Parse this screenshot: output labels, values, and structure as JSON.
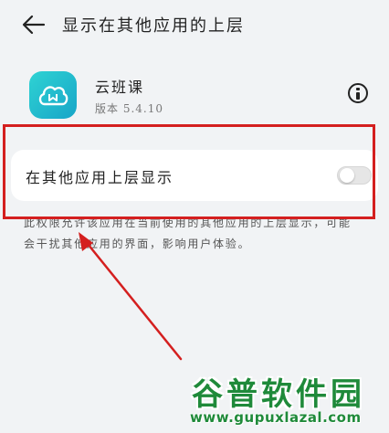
{
  "header": {
    "title": "显示在其他应用的上层"
  },
  "app": {
    "name": "云班课",
    "version": "版本 5.4.10"
  },
  "setting": {
    "label": "在其他应用上层显示",
    "enabled": false
  },
  "description": "此权限允许该应用在当前使用的其他应用的上层显示，可能会干扰其他应用的界面，影响用户体验。",
  "watermark": {
    "title": "谷普软件园",
    "url": "www.gupuxlazal.com"
  },
  "colors": {
    "accent": "#17a5c8",
    "annotation": "#d41f1f",
    "watermark": "#1f8a3a"
  },
  "icons": {
    "back": "arrow-left-icon",
    "info": "info-icon",
    "app": "cloud-book-icon"
  }
}
